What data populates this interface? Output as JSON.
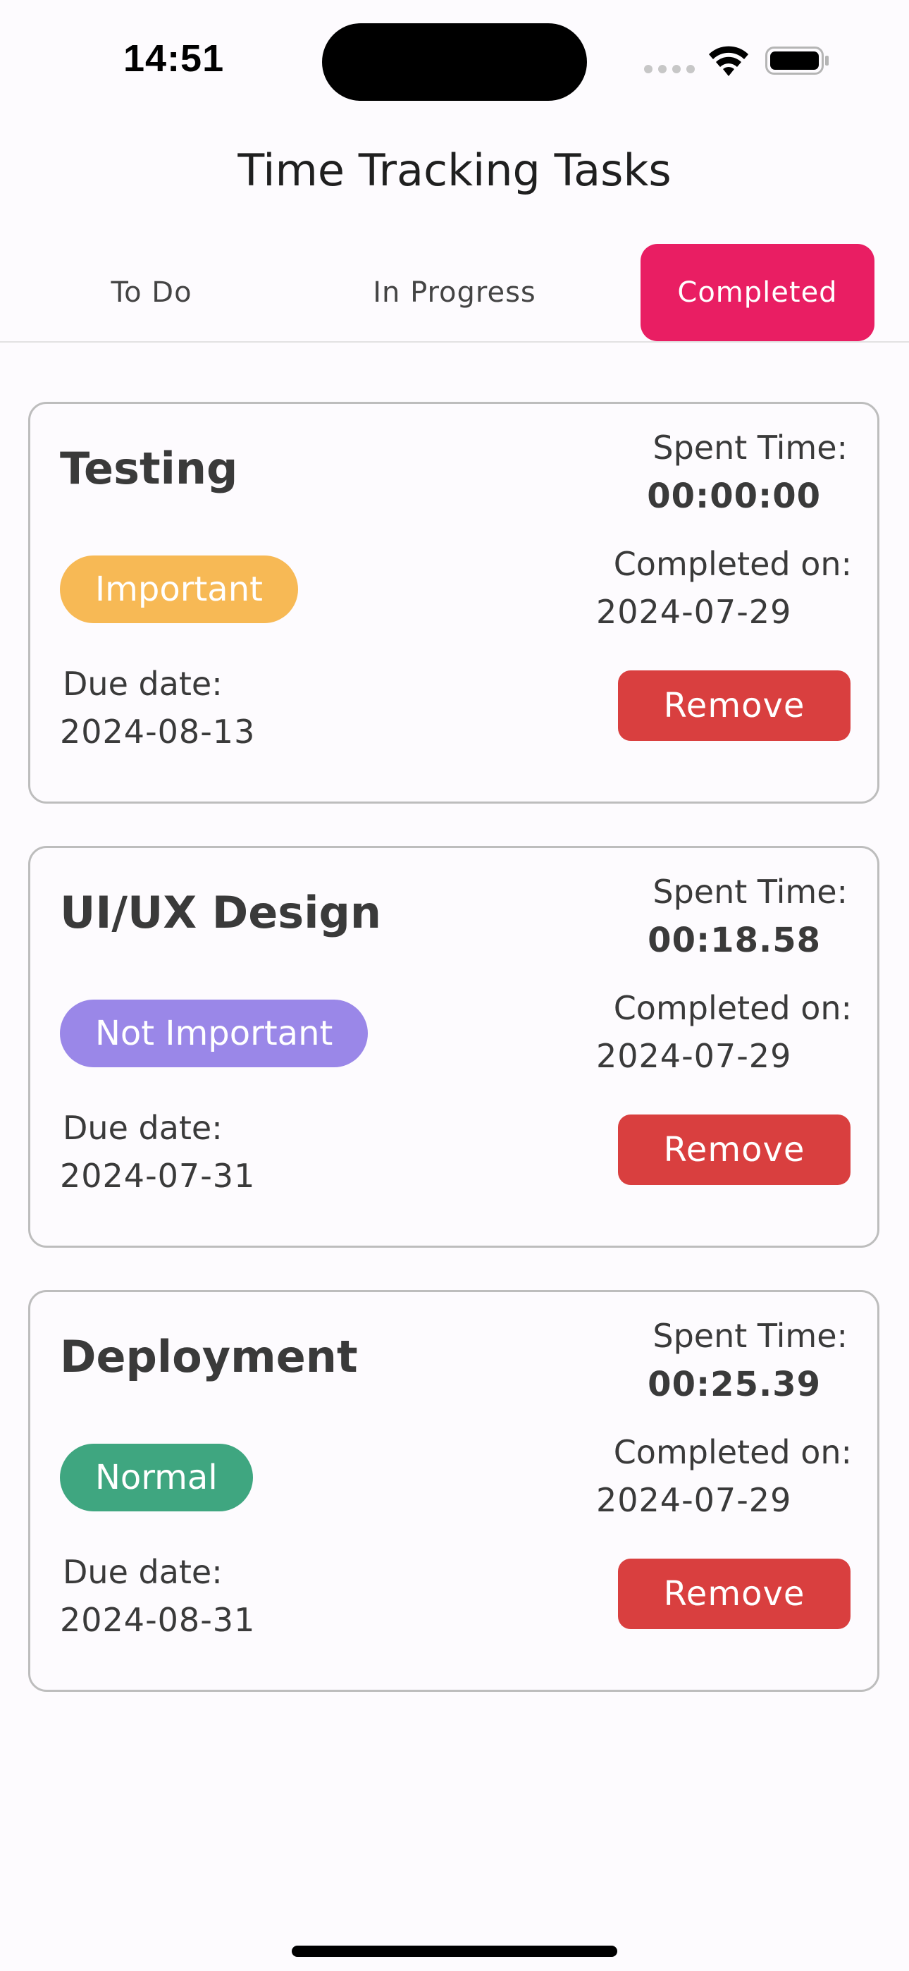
{
  "status_bar": {
    "time": "14:51"
  },
  "header": {
    "title": "Time Tracking Tasks"
  },
  "tabs": [
    {
      "label": "To Do",
      "selected": false
    },
    {
      "label": "In Progress",
      "selected": false
    },
    {
      "label": "Completed",
      "selected": true
    }
  ],
  "colors": {
    "accent": "#e91e63",
    "remove": "#d93f3f",
    "important": "#f7b955",
    "not_important": "#9a87e8",
    "normal": "#3fa680"
  },
  "labels": {
    "spent_time": "Spent Time:",
    "completed_on": "Completed on:",
    "due_date": "Due date:",
    "remove": "Remove"
  },
  "tasks": [
    {
      "title": "Testing",
      "priority": "Important",
      "priority_color": "#f7b955",
      "spent_time": "00:00:00",
      "completed_on": "2024-07-29",
      "due_date": "2024-08-13"
    },
    {
      "title": "UI/UX Design",
      "priority": "Not Important",
      "priority_color": "#9a87e8",
      "spent_time": "00:18.58",
      "completed_on": "2024-07-29",
      "due_date": "2024-07-31"
    },
    {
      "title": "Deployment",
      "priority": "Normal",
      "priority_color": "#3fa680",
      "spent_time": "00:25.39",
      "completed_on": "2024-07-29",
      "due_date": "2024-08-31"
    }
  ]
}
